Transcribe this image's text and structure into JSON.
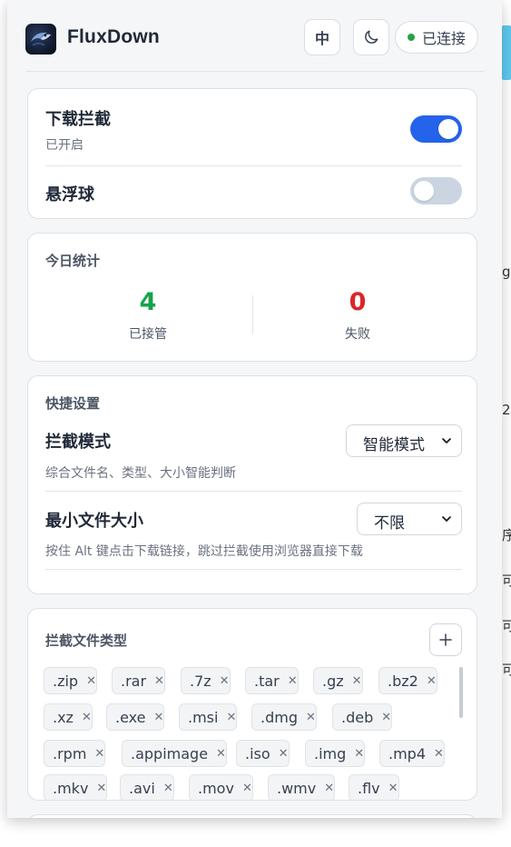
{
  "header": {
    "app_name": "FluxDown",
    "lang_button": "中",
    "status": "已连接",
    "status_color": "#22a447"
  },
  "interception": {
    "download_title": "下载拦截",
    "download_status": "已开启",
    "download_enabled": true,
    "floating_ball_title": "悬浮球",
    "floating_ball_enabled": false
  },
  "stats": {
    "title": "今日统计",
    "taken_value": "4",
    "taken_label": "已接管",
    "failed_value": "0",
    "failed_label": "失败"
  },
  "quick_settings": {
    "title": "快捷设置",
    "mode_label": "拦截模式",
    "mode_value": "智能模式",
    "mode_desc": "综合文件名、类型、大小智能判断",
    "min_size_label": "最小文件大小",
    "min_size_value": "不限",
    "min_size_desc": "按住 Alt 键点击下载链接，跳过拦截使用浏览器直接下载"
  },
  "file_types": {
    "title": "拦截文件类型",
    "tags": [
      ".zip",
      ".rar",
      ".7z",
      ".tar",
      ".gz",
      ".bz2",
      ".xz",
      ".exe",
      ".msi",
      ".dmg",
      ".deb",
      ".rpm",
      ".appimage",
      ".iso",
      ".img",
      ".mp4",
      ".mkv",
      ".avi",
      ".mov",
      ".wmv",
      ".flv"
    ]
  },
  "colors": {
    "accent": "#2563eb",
    "success": "#16a34a",
    "danger": "#dc2626"
  }
}
